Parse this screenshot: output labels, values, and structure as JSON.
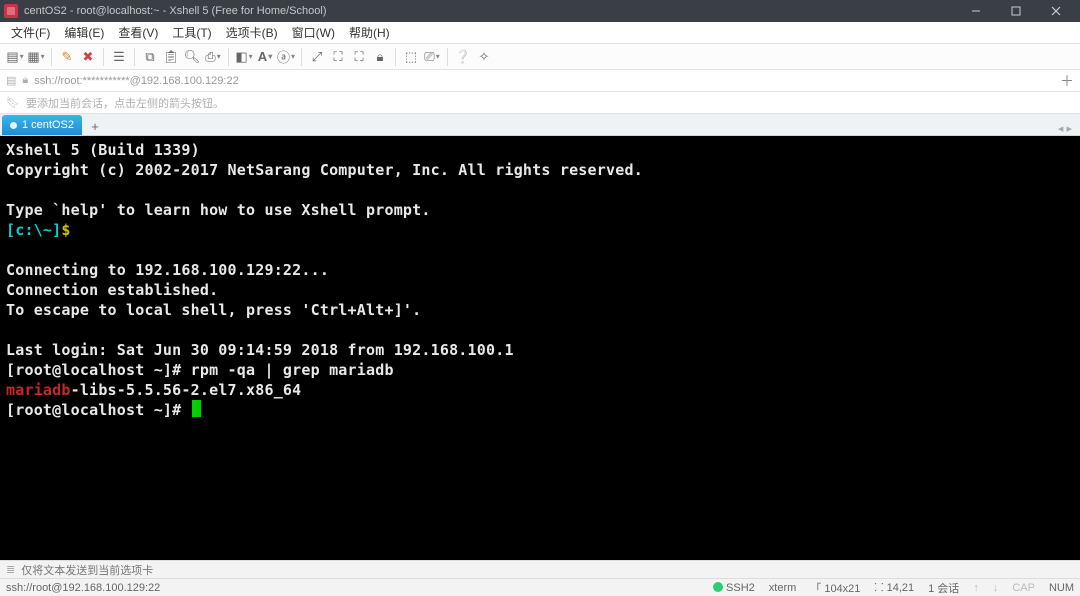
{
  "titlebar": {
    "title": "centOS2 - root@localhost:~ - Xshell 5 (Free for Home/School)"
  },
  "menu": {
    "file": "文件(F)",
    "edit": "编辑(E)",
    "view": "查看(V)",
    "tools": "工具(T)",
    "tab": "选项卡(B)",
    "window": "窗口(W)",
    "help": "帮助(H)"
  },
  "addr": {
    "text": "ssh://root:***********@192.168.100.129:22"
  },
  "hint": {
    "text": "要添加当前会话，点击左侧的箭头按钮。"
  },
  "tab": {
    "label": "1 centOS2"
  },
  "tabstrip_right": "◂  ▸",
  "term": {
    "l1": "Xshell 5 (Build 1339)",
    "l2": "Copyright (c) 2002-2017 NetSarang Computer, Inc. All rights reserved.",
    "l3": "",
    "l4": "Type `help' to learn how to use Xshell prompt.",
    "p1a": "[c:\\~]",
    "p1b": "$",
    "l6": "",
    "l7": "Connecting to 192.168.100.129:22...",
    "l8": "Connection established.",
    "l9": "To escape to local shell, press 'Ctrl+Alt+]'.",
    "l10": "",
    "l11": "Last login: Sat Jun 30 09:14:59 2018 from 192.168.100.1",
    "l12": "[root@localhost ~]# rpm -qa | grep mariadb",
    "l13a": "mariadb",
    "l13b": "-libs-5.5.56-2.el7.x86_64",
    "l14": "[root@localhost ~]# "
  },
  "status1": {
    "text": "仅将文本发送到当前选项卡"
  },
  "status2": {
    "left": "ssh://root@192.168.100.129:22",
    "ssh": "SSH2",
    "term": "xterm",
    "size": "「 104x21",
    "pos": "⸬ 14,21",
    "sess": "1 会话",
    "ping_label_a": "↑",
    "ping_label_b": "↓",
    "cap": "CAP",
    "num": "NUM"
  }
}
